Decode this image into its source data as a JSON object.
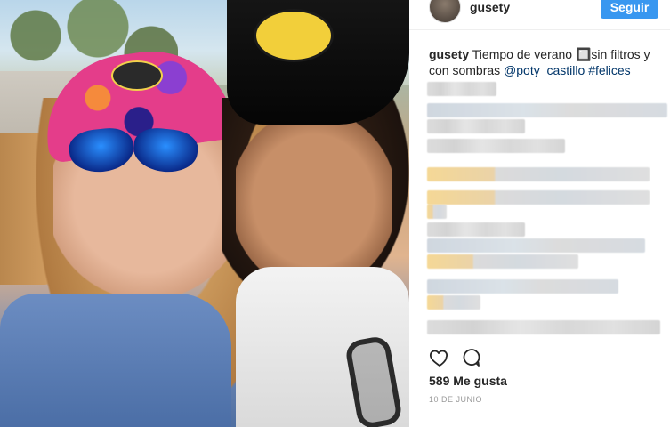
{
  "post": {
    "username": "gusety",
    "follow_label": "Seguir",
    "caption": {
      "user": "gusety",
      "text": "Tiempo de verano 🔲sin filtros y con sombras",
      "mention": "@poty_castillo",
      "hashtag": "#felices"
    },
    "likes_label": "589 Me gusta",
    "date_label": "10 DE JUNIO"
  },
  "icons": {
    "like": "heart-icon",
    "comment": "comment-icon"
  },
  "colors": {
    "follow_button": "#3897f0",
    "link": "#003569",
    "date": "#999999"
  }
}
